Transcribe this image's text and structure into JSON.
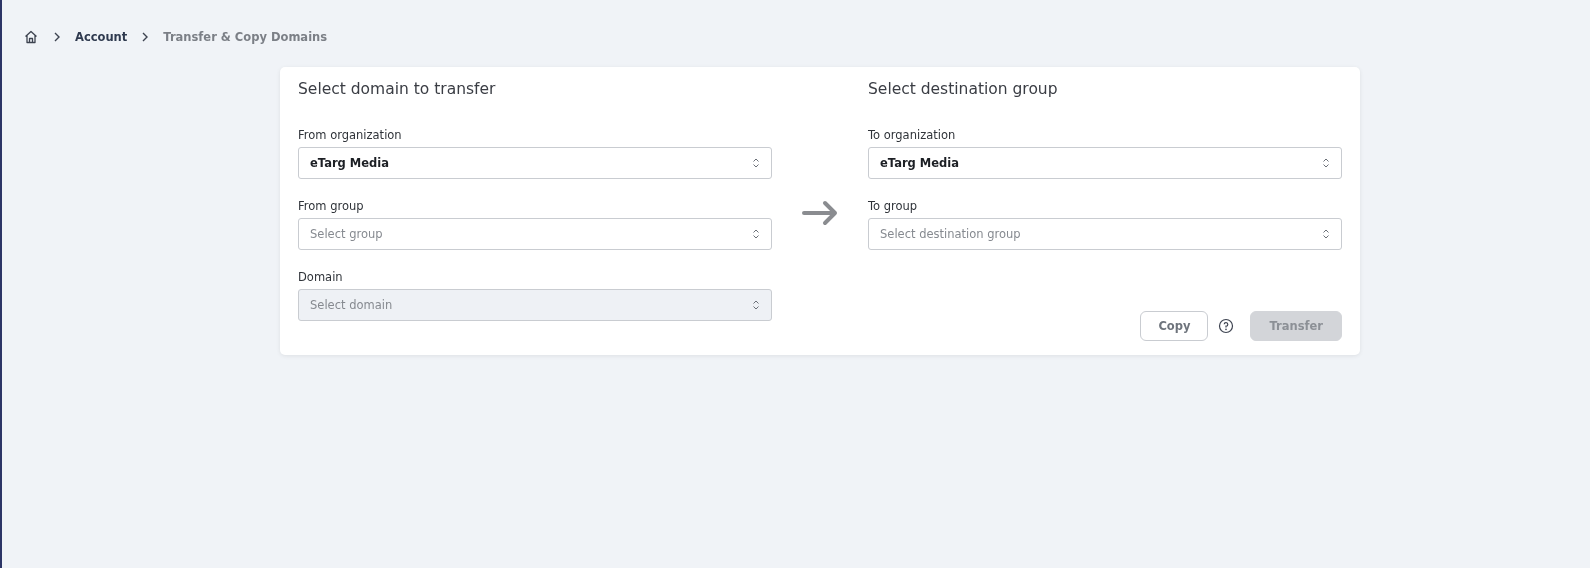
{
  "breadcrumb": [
    {
      "label": "Account",
      "current": false
    },
    {
      "label": "Transfer & Copy Domains",
      "current": true
    }
  ],
  "source": {
    "title": "Select domain to transfer",
    "fields": [
      {
        "label": "From organization",
        "value": "eTarg Media",
        "disabled": false
      },
      {
        "label": "From group",
        "placeholder": "Select group",
        "disabled": false
      },
      {
        "label": "Domain",
        "placeholder": "Select domain",
        "disabled": true
      }
    ]
  },
  "destination": {
    "title": "Select destination group",
    "fields": [
      {
        "label": "To organization",
        "value": "eTarg Media",
        "disabled": false
      },
      {
        "label": "To group",
        "placeholder": "Select destination group",
        "disabled": false
      }
    ]
  },
  "actions": [
    {
      "label": "Copy",
      "disabled": false
    },
    {
      "label": "Transfer",
      "disabled": true
    }
  ]
}
